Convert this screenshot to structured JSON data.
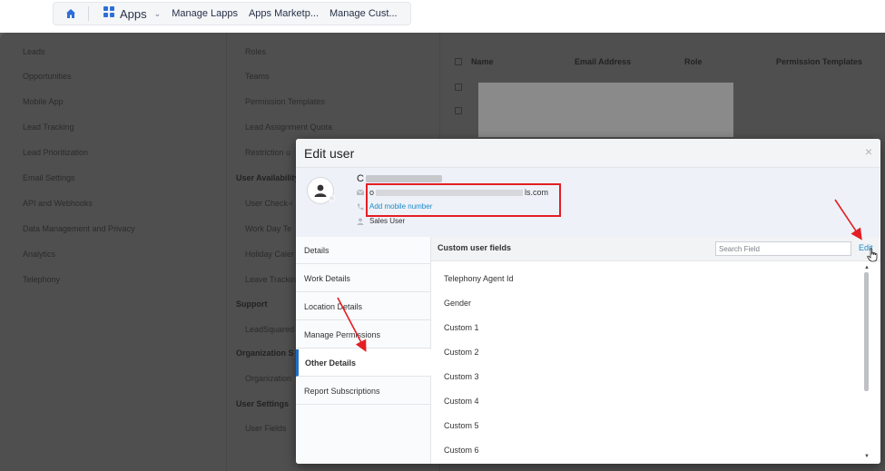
{
  "topbar": {
    "apps_label": "Apps",
    "tabs": [
      "Manage Lapps",
      "Apps Marketp...",
      "Manage Cust..."
    ]
  },
  "background": {
    "left_menu": [
      "Leads",
      "Opportunities",
      "Mobile App",
      "Lead Tracking",
      "Lead Prioritization",
      "Email Settings",
      "API and Webhooks",
      "Data Management and Privacy",
      "Analytics",
      "Telephony"
    ],
    "mid_menu": {
      "items_top": [
        "Roles",
        "Teams",
        "Permission Templates",
        "Lead Assignment Quota",
        "Restriction u"
      ],
      "section_availability": "User Availability",
      "availability_items": [
        "User Check-i",
        "Work Day Te",
        "Holiday Caler",
        "Leave Trackin"
      ],
      "section_support": "Support",
      "support_items": [
        "LeadSquared"
      ],
      "section_org": "Organization S",
      "org_items": [
        "Organization"
      ],
      "section_user_settings": "User Settings",
      "user_settings_items": [
        "User Fields"
      ]
    },
    "table_headers": [
      "Name",
      "Email Address",
      "Role",
      "Permission Templates"
    ]
  },
  "modal": {
    "title": "Edit user",
    "close_symbol": "×",
    "user": {
      "name_initial": "C",
      "email_prefix": "o",
      "email_suffix": "ls.com",
      "add_mobile_label": "Add mobile number",
      "role": "Sales User"
    },
    "tabs": [
      "Details",
      "Work Details",
      "Location Details",
      "Manage Permissions",
      "Other Details",
      "Report Subscriptions"
    ],
    "active_tab": "Other Details",
    "content": {
      "title": "Custom user fields",
      "search_placeholder": "Search Field",
      "edit_label": "Edit",
      "fields": [
        "Telephony Agent Id",
        "Gender",
        "Custom 1",
        "Custom 2",
        "Custom 3",
        "Custom 4",
        "Custom 5",
        "Custom 6"
      ]
    }
  },
  "colors": {
    "accent_blue": "#1e88c8",
    "active_tab_border": "#1e6fc4",
    "annotation_red": "#e31e24"
  }
}
